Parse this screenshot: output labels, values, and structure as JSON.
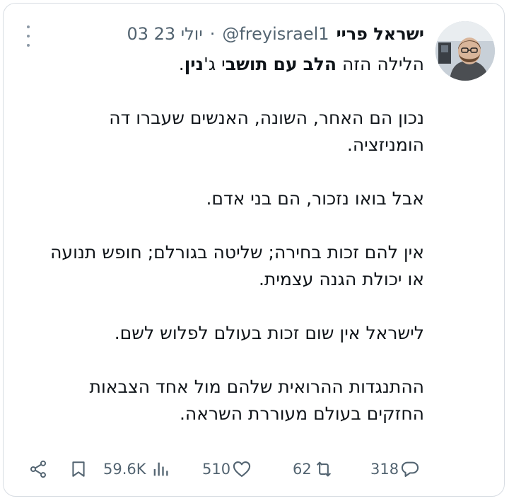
{
  "tweet": {
    "author_name": "ישראל פריי",
    "handle": "@freyisrael1",
    "separator": "·",
    "date": "03 יולי 23",
    "line1_a": "הלילה הזה ",
    "line1_b": "הלב",
    "line1_c": " ",
    "line1_d": "עם",
    "line1_e": " ",
    "line1_f": "תושב",
    "line1_g": "י ג'",
    "line1_h": "נין",
    "line1_i": ".",
    "p2": "נכון הם האחר, השונה, האנשים שעברו דה הומניזציה.",
    "p3": "אבל בואו נזכור, הם בני אדם.",
    "p4": "אין להם זכות בחירה; שליטה בגורלם; חופש תנועה או יכולת הגנה עצמית.",
    "p5": "לישראל אין שום זכות בעולם לפלוש לשם.",
    "p6": "ההתנגדות ההרואית שלהם מול אחד הצבאות החזקים בעולם מעוררת השראה."
  },
  "actions": {
    "views": "59.6K",
    "likes": "510",
    "retweets": "62",
    "replies": "318"
  },
  "icons": {
    "share": "share-icon",
    "bookmark": "bookmark-icon",
    "views": "views-icon",
    "like": "heart-icon",
    "retweet": "retweet-icon",
    "reply": "reply-icon",
    "more": "more-icon"
  },
  "colors": {
    "text": "#0f1419",
    "muted": "#536471",
    "border": "#d8dde3"
  }
}
